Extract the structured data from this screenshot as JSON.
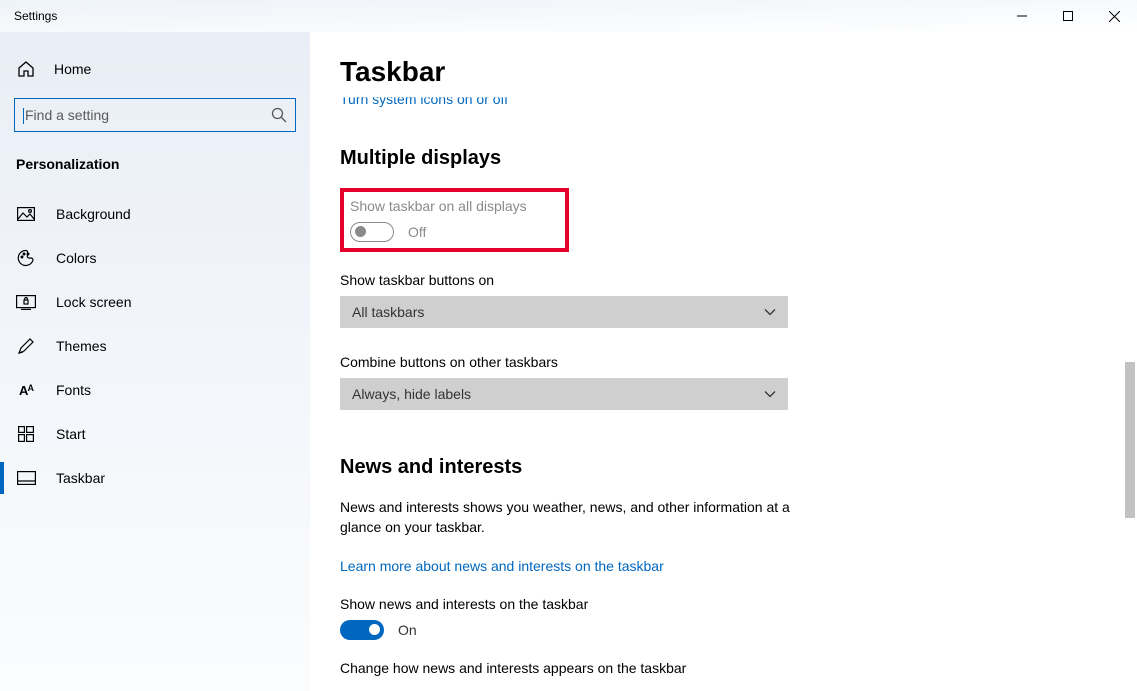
{
  "window": {
    "title": "Settings"
  },
  "sidebar": {
    "home_label": "Home",
    "search_placeholder": "Find a setting",
    "section_label": "Personalization",
    "items": [
      {
        "label": "Background"
      },
      {
        "label": "Colors"
      },
      {
        "label": "Lock screen"
      },
      {
        "label": "Themes"
      },
      {
        "label": "Fonts"
      },
      {
        "label": "Start"
      },
      {
        "label": "Taskbar"
      }
    ]
  },
  "main": {
    "page_title": "Taskbar",
    "cutoff_link": "Turn system icons on or off",
    "multiple_displays": {
      "heading": "Multiple displays",
      "show_all_label": "Show taskbar on all displays",
      "show_all_state": "Off",
      "buttons_on_label": "Show taskbar buttons on",
      "buttons_on_value": "All taskbars",
      "combine_label": "Combine buttons on other taskbars",
      "combine_value": "Always, hide labels"
    },
    "news": {
      "heading": "News and interests",
      "body": "News and interests shows you weather, news, and other information at a glance on your taskbar.",
      "learn_link": "Learn more about news and interests on the taskbar",
      "show_label": "Show news and interests on the taskbar",
      "show_state": "On",
      "appearance_label": "Change how news and interests appears on the taskbar"
    }
  }
}
